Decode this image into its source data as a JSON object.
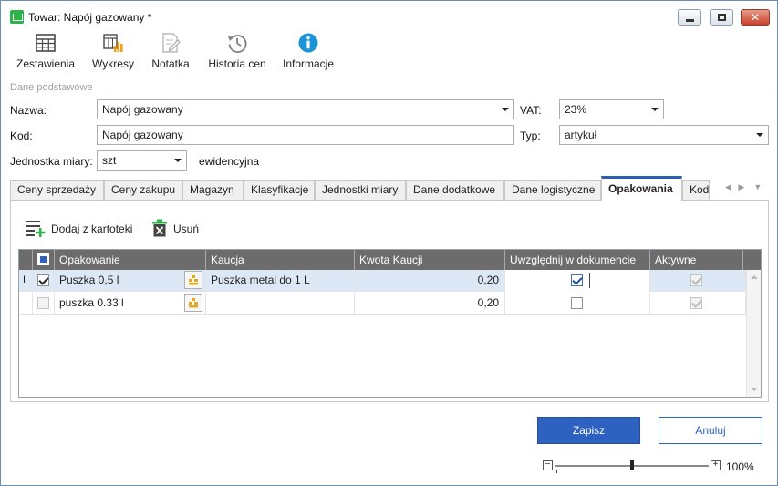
{
  "window": {
    "title": "Towar: Napój gazowany *",
    "minimize_icon": "minimize-icon",
    "maximize_icon": "maximize-icon",
    "close_icon": "close-icon"
  },
  "toolbar": {
    "items": [
      {
        "label": "Zestawienia",
        "icon": "table-icon"
      },
      {
        "label": "Wykresy",
        "icon": "chart-icon"
      },
      {
        "label": "Notatka",
        "icon": "note-icon"
      },
      {
        "label": "Historia cen",
        "icon": "history-icon"
      },
      {
        "label": "Informacje",
        "icon": "info-icon"
      }
    ]
  },
  "form": {
    "section_title": "Dane podstawowe",
    "name_label": "Nazwa:",
    "name_value": "Napój gazowany",
    "vat_label": "VAT:",
    "vat_value": "23%",
    "code_label": "Kod:",
    "code_value": "Napój gazowany",
    "type_label": "Typ:",
    "type_value": "artykuł",
    "unit_label": "Jednostka miary:",
    "unit_value": "szt",
    "unit_note": "ewidencyjna"
  },
  "tabs": [
    {
      "label": "Ceny sprzedaży"
    },
    {
      "label": "Ceny zakupu"
    },
    {
      "label": "Magazyn"
    },
    {
      "label": "Klasyfikacje"
    },
    {
      "label": "Jednostki miary"
    },
    {
      "label": "Dane dodatkowe"
    },
    {
      "label": "Dane logistyczne"
    },
    {
      "label": "Opakowania"
    },
    {
      "label": "Kod"
    }
  ],
  "active_tab": "Opakowania",
  "panel": {
    "add_label": "Dodaj z kartoteki",
    "delete_label": "Usuń",
    "columns": [
      "Opakowanie",
      "Kaucja",
      "Kwota Kaucji",
      "Uwzględnij w dokumencie",
      "Aktywne"
    ],
    "rows": [
      {
        "marker": "I",
        "checked": true,
        "name": "Puszka 0,5 l",
        "deposit": "Puszka metal do 1 L",
        "amount": "0,20",
        "include": true,
        "active": true,
        "selected": true
      },
      {
        "marker": "",
        "checked": false,
        "name": "puszka 0.33 l",
        "deposit": "",
        "amount": "0,20",
        "include": false,
        "active": true,
        "selected": false
      }
    ]
  },
  "buttons": {
    "save": "Zapisz",
    "cancel": "Anuluj"
  },
  "zoom": {
    "minus": "−",
    "plus": "+",
    "value": "100%",
    "level": 0.5
  },
  "colors": {
    "accent": "#2e62c0",
    "header_bg": "#6c6c6c",
    "selected_row": "#dde8f6"
  }
}
